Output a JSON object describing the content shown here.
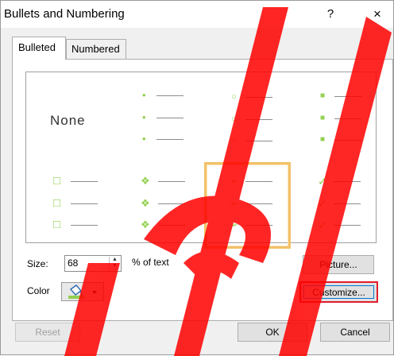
{
  "window": {
    "title": "Bullets and Numbering",
    "help_label": "?",
    "close_label": "×"
  },
  "tabs": [
    {
      "label": "Bulleted",
      "active": true
    },
    {
      "label": "Numbered",
      "active": false
    }
  ],
  "bullets": {
    "accent_color": "#92d050",
    "none_label": "None",
    "options": [
      {
        "name": "none"
      },
      {
        "name": "filled-round",
        "glyph": "•"
      },
      {
        "name": "hollow-round",
        "glyph": "○"
      },
      {
        "name": "filled-square",
        "glyph": "■"
      },
      {
        "name": "hollow-square",
        "glyph": "□"
      },
      {
        "name": "star-cluster",
        "glyph": "❖"
      },
      {
        "name": "arrow",
        "glyph": "➢",
        "selected": true
      },
      {
        "name": "checkmark",
        "glyph": "✓"
      }
    ]
  },
  "size": {
    "label": "Size:",
    "value": "68",
    "suffix": "% of text"
  },
  "color": {
    "label": "Color",
    "swatch": "#92d050"
  },
  "buttons": {
    "picture": "Picture...",
    "customize": "Customize...",
    "reset": "Reset",
    "ok": "OK",
    "cancel": "Cancel"
  }
}
